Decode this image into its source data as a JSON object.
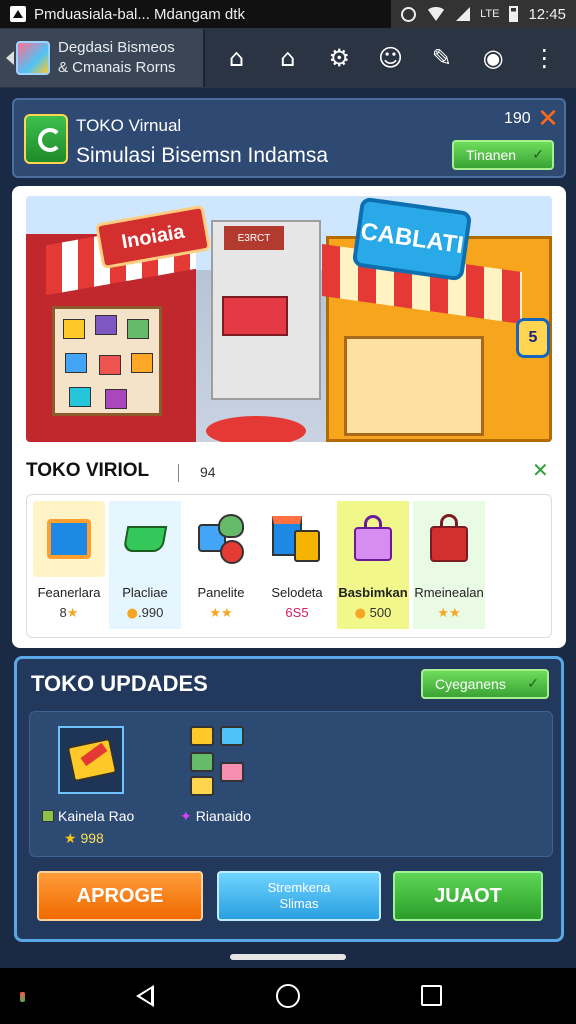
{
  "status_bar": {
    "notification_text": "Pmduasiala-bal... Mdangam dtk",
    "lte_label": "LTE",
    "time": "12:45"
  },
  "browser": {
    "tab_title_line1": "Degdasi Bismeos",
    "tab_title_line2": "& Cmanais Rorns",
    "toolbar_icons": [
      "home-outline-icon",
      "home-icon",
      "gear-icon",
      "gamepad-icon",
      "lightbulb-icon",
      "camera-icon",
      "more-vert-icon"
    ]
  },
  "header": {
    "subtitle": "TOKO Virnual",
    "title": "Simulasi Bisemsn Indamsa",
    "count": "190",
    "dropdown_label": "Tinanen"
  },
  "hero": {
    "left_sign": "Inoiaia",
    "right_sign": "CABLATI",
    "middle_sign": "E3RCT",
    "badge": "5"
  },
  "catalog": {
    "title": "TOKO VIRIOL",
    "count": "94",
    "items": [
      {
        "name": "Feanerlara",
        "price": "8",
        "icon": "laptop-box-icon",
        "color": "#ff9f2e"
      },
      {
        "name": "Placliae",
        "price": ".990",
        "icon": "shopping-cart-icon",
        "color": "#34c759"
      },
      {
        "name": "Panelite",
        "price": "",
        "icon": "fruit-basket-icon",
        "color": "#e53935"
      },
      {
        "name": "Selodeta",
        "price": "6S5",
        "icon": "shopping-bags-icon",
        "color": "#f4b400"
      },
      {
        "name": "Basbimkan",
        "price": "500",
        "icon": "handbag-icon",
        "color": "#d68cf0"
      },
      {
        "name": "Rmeinealan",
        "price": "",
        "icon": "red-bag-icon",
        "color": "#d32f2f"
      }
    ]
  },
  "updates": {
    "title": "TOKO UPDADES",
    "dropdown_label": "Cyeganens",
    "item1_name": "Kainela Rao",
    "item1_price": "998",
    "item2_name": "Rianaido",
    "buttons": {
      "orange": "APROGE",
      "blue_line1": "Stremkena",
      "blue_line2": "Slimas",
      "green": "JUAOT"
    }
  }
}
